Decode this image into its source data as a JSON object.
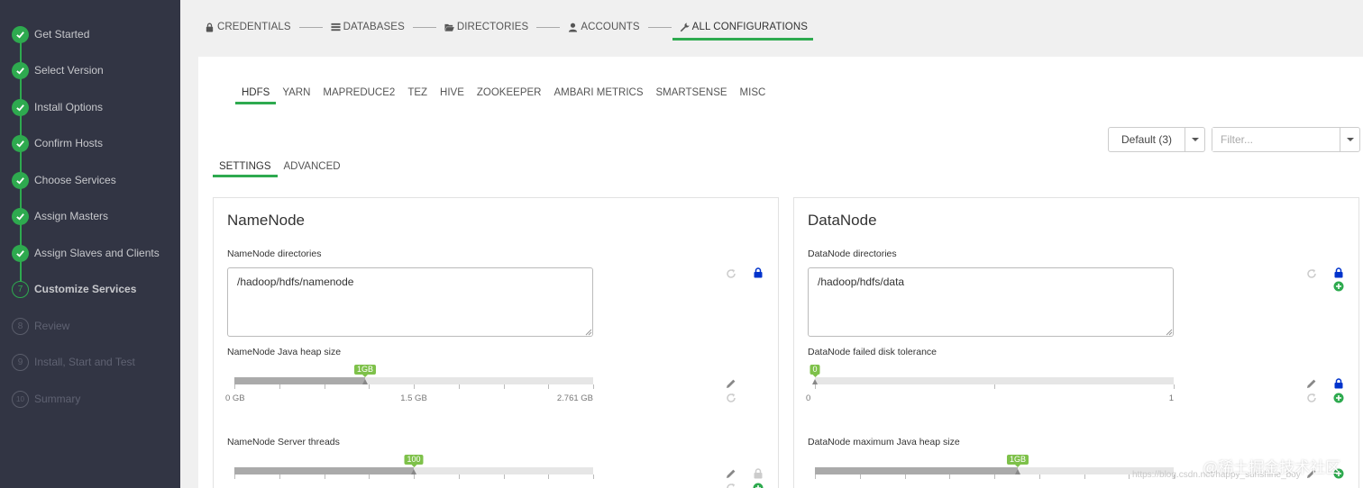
{
  "sidebar": {
    "steps": [
      {
        "label": "Get Started",
        "status": "done"
      },
      {
        "label": "Select Version",
        "status": "done"
      },
      {
        "label": "Install Options",
        "status": "done"
      },
      {
        "label": "Confirm Hosts",
        "status": "done"
      },
      {
        "label": "Choose Services",
        "status": "done"
      },
      {
        "label": "Assign Masters",
        "status": "done"
      },
      {
        "label": "Assign Slaves and Clients",
        "status": "done"
      },
      {
        "label": "Customize Services",
        "status": "current",
        "number": "7"
      },
      {
        "label": "Review",
        "status": "todo",
        "number": "8"
      },
      {
        "label": "Install, Start and Test",
        "status": "todo",
        "number": "9"
      },
      {
        "label": "Summary",
        "status": "todo",
        "number": "10"
      }
    ]
  },
  "topnav": {
    "items": [
      {
        "label": "CREDENTIALS",
        "icon": "lock-icon"
      },
      {
        "label": "DATABASES",
        "icon": "list-icon"
      },
      {
        "label": "DIRECTORIES",
        "icon": "folder-open-icon"
      },
      {
        "label": "ACCOUNTS",
        "icon": "user-icon"
      },
      {
        "label": "ALL CONFIGURATIONS",
        "icon": "wrench-icon",
        "active": true
      }
    ]
  },
  "service_tabs": [
    "HDFS",
    "YARN",
    "MAPREDUCE2",
    "TEZ",
    "HIVE",
    "ZOOKEEPER",
    "AMBARI METRICS",
    "SMARTSENSE",
    "MISC"
  ],
  "config_group": {
    "selected": "Default (3)"
  },
  "filter": {
    "placeholder": "Filter..."
  },
  "sub_tabs": [
    "SETTINGS",
    "ADVANCED"
  ],
  "namenode": {
    "title": "NameNode",
    "directories_label": "NameNode directories",
    "directories_value": "/hadoop/hdfs/namenode",
    "heap_label": "NameNode Java heap size",
    "heap_value": "1GB",
    "heap_fraction": 0.365,
    "heap_ticks": [
      "0 GB",
      "1.5 GB",
      "2.761 GB"
    ],
    "threads_label": "NameNode Server threads",
    "threads_value": "100",
    "threads_fraction": 0.5
  },
  "datanode": {
    "title": "DataNode",
    "directories_label": "DataNode directories",
    "directories_value": "/hadoop/hdfs/data",
    "disk_label": "DataNode failed disk tolerance",
    "disk_value": "0",
    "disk_fraction": 0.0,
    "disk_ticks": [
      "0",
      "1"
    ],
    "heap_label": "DataNode maximum Java heap size",
    "heap_value": "1GB",
    "heap_fraction": 0.565
  },
  "watermark": {
    "text": "@稀土掘金技术社区",
    "url": "https://blog.csdn.net/happy_sunshine_boy"
  },
  "colors": {
    "sidebar_bg": "#323544",
    "accent": "#2eaa4f",
    "slider_bubble": "#7ec14a",
    "lock_blue": "#0033cc"
  }
}
